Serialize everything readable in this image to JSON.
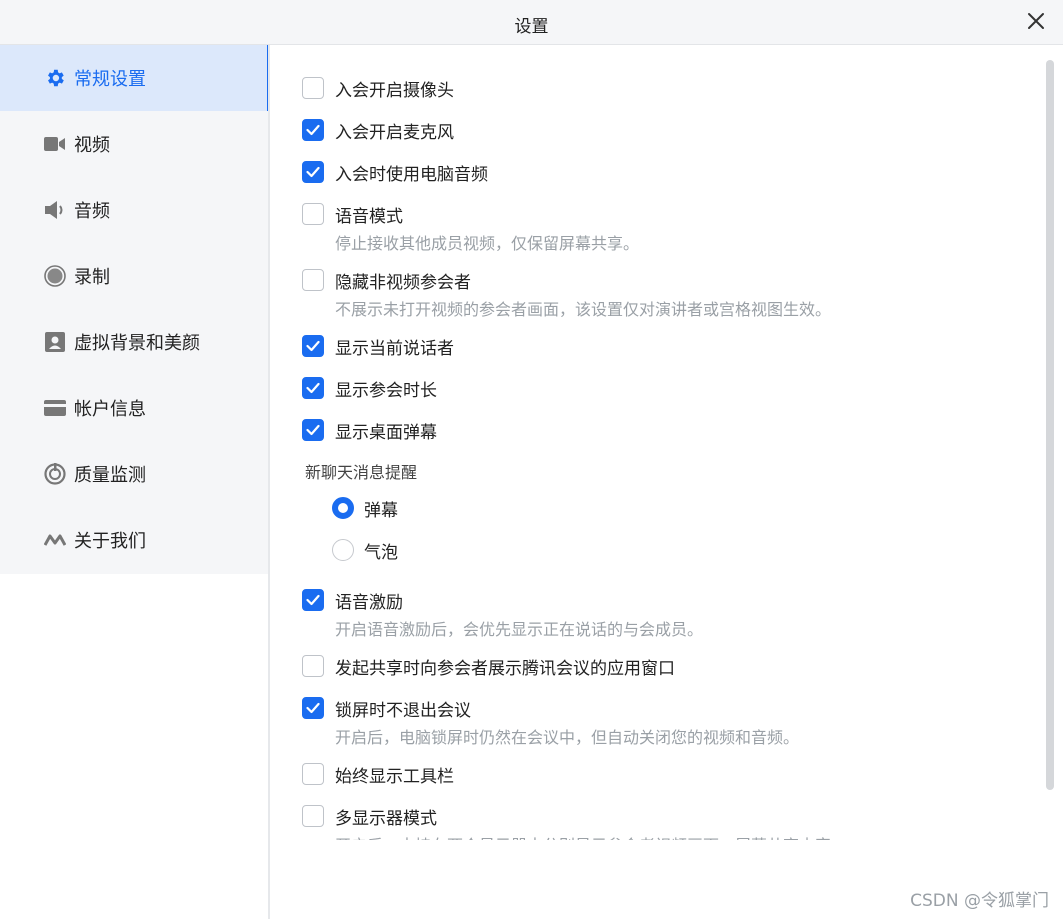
{
  "window": {
    "title": "设置"
  },
  "sidebar": {
    "items": [
      {
        "label": "常规设置",
        "icon": "gear-icon",
        "active": true
      },
      {
        "label": "视频",
        "icon": "video-camera-icon",
        "active": false
      },
      {
        "label": "音频",
        "icon": "speaker-icon",
        "active": false
      },
      {
        "label": "录制",
        "icon": "record-icon",
        "active": false
      },
      {
        "label": "虚拟背景和美颜",
        "icon": "portrait-icon",
        "active": false
      },
      {
        "label": "帐户信息",
        "icon": "card-icon",
        "active": false
      },
      {
        "label": "质量监测",
        "icon": "monitor-icon",
        "active": false
      },
      {
        "label": "关于我们",
        "icon": "about-icon",
        "active": false
      }
    ]
  },
  "options": [
    {
      "label": "入会开启摄像头",
      "checked": false,
      "desc": ""
    },
    {
      "label": "入会开启麦克风",
      "checked": true,
      "desc": ""
    },
    {
      "label": "入会时使用电脑音频",
      "checked": true,
      "desc": ""
    },
    {
      "label": "语音模式",
      "checked": false,
      "desc": "停止接收其他成员视频，仅保留屏幕共享。"
    },
    {
      "label": "隐藏非视频参会者",
      "checked": false,
      "desc": "不展示未打开视频的参会者画面，该设置仅对演讲者或宫格视图生效。"
    },
    {
      "label": "显示当前说话者",
      "checked": true,
      "desc": ""
    },
    {
      "label": "显示参会时长",
      "checked": true,
      "desc": ""
    },
    {
      "label": "显示桌面弹幕",
      "checked": true,
      "desc": ""
    },
    {
      "label": "语音激励",
      "checked": true,
      "desc": "开启语音激励后，会优先显示正在说话的与会成员。"
    },
    {
      "label": "发起共享时向参会者展示腾讯会议的应用窗口",
      "checked": false,
      "desc": ""
    },
    {
      "label": "锁屏时不退出会议",
      "checked": true,
      "desc": "开启后，电脑锁屏时仍然在会议中，但自动关闭您的视频和音频。"
    },
    {
      "label": "始终显示工具栏",
      "checked": false,
      "desc": ""
    },
    {
      "label": "多显示器模式",
      "checked": false,
      "desc": "开启后，支持在两个显示器中分别显示参会者视频画面、屏幕共享内容"
    }
  ],
  "chat_notify": {
    "label": "新聊天消息提醒",
    "options": [
      {
        "label": "弹幕",
        "selected": true
      },
      {
        "label": "气泡",
        "selected": false
      }
    ]
  },
  "watermark": "CSDN @令狐掌门",
  "colors": {
    "accent": "#1a6cf0",
    "sidebar_bg": "#f5f6f8",
    "active_bg": "#dce8fb"
  }
}
